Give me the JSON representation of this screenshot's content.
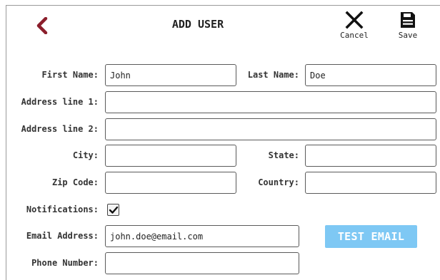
{
  "header": {
    "title": "ADD USER",
    "cancel_label": "Cancel",
    "save_label": "Save",
    "back_icon": "chevron-left-icon",
    "accent_color": "#8b1e2b"
  },
  "form": {
    "first_name": {
      "label": "First Name:",
      "value": "John"
    },
    "last_name": {
      "label": "Last Name:",
      "value": "Doe"
    },
    "address1": {
      "label": "Address line 1:",
      "value": ""
    },
    "address2": {
      "label": "Address line 2:",
      "value": ""
    },
    "city": {
      "label": "City:",
      "value": ""
    },
    "state": {
      "label": "State:",
      "value": ""
    },
    "zip": {
      "label": "Zip Code:",
      "value": ""
    },
    "country": {
      "label": "Country:",
      "value": ""
    },
    "notifications": {
      "label": "Notifications:",
      "checked": true
    },
    "email": {
      "label": "Email Address:",
      "value": "john.doe@email.com"
    },
    "phone": {
      "label": "Phone Number:",
      "value": ""
    },
    "test_email_label": "TEST EMAIL",
    "test_email_color": "#7ec8f4"
  }
}
